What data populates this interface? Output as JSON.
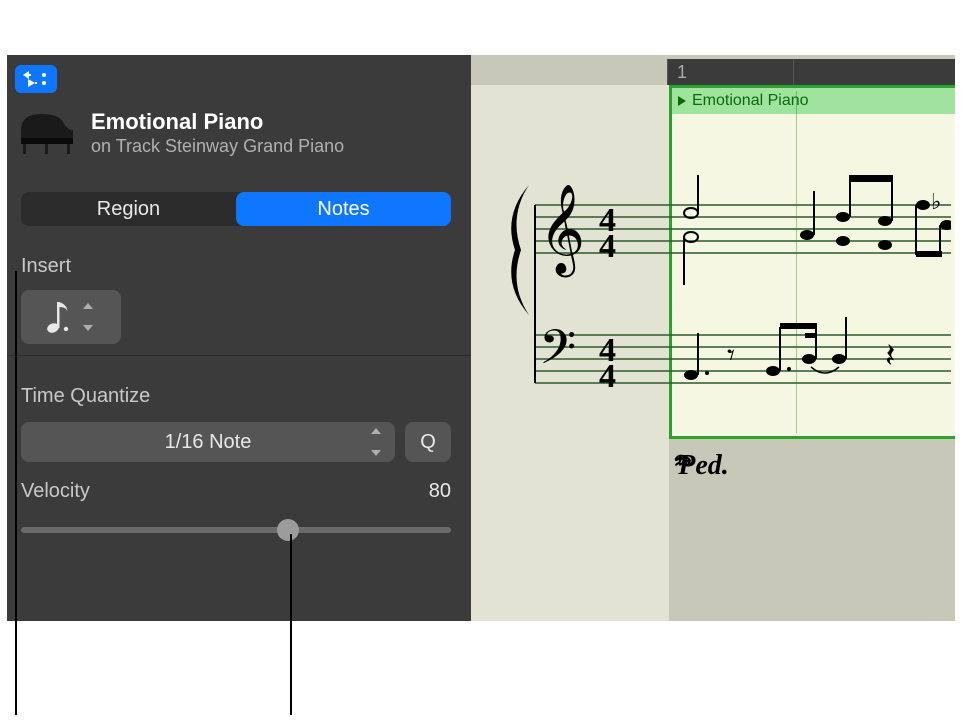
{
  "inspector": {
    "region_name": "Emotional Piano",
    "track_line": "on Track Steinway Grand Piano",
    "tabs": {
      "region": "Region",
      "notes": "Notes"
    },
    "insert_label": "Insert",
    "time_quantize_label": "Time Quantize",
    "tq_value": "1/16 Note",
    "q_button": "Q",
    "velocity_label": "Velocity",
    "velocity_value": "80"
  },
  "score": {
    "ruler_marker": "1",
    "region_label": "Emotional Piano",
    "time_sig_top": "4",
    "time_sig_bottom": "4",
    "pedal_mark": "Ped."
  },
  "icons": {
    "catch": "catch-playhead-icon",
    "piano": "grand-piano-icon",
    "note_insert": "dotted-eighth-note-icon"
  }
}
